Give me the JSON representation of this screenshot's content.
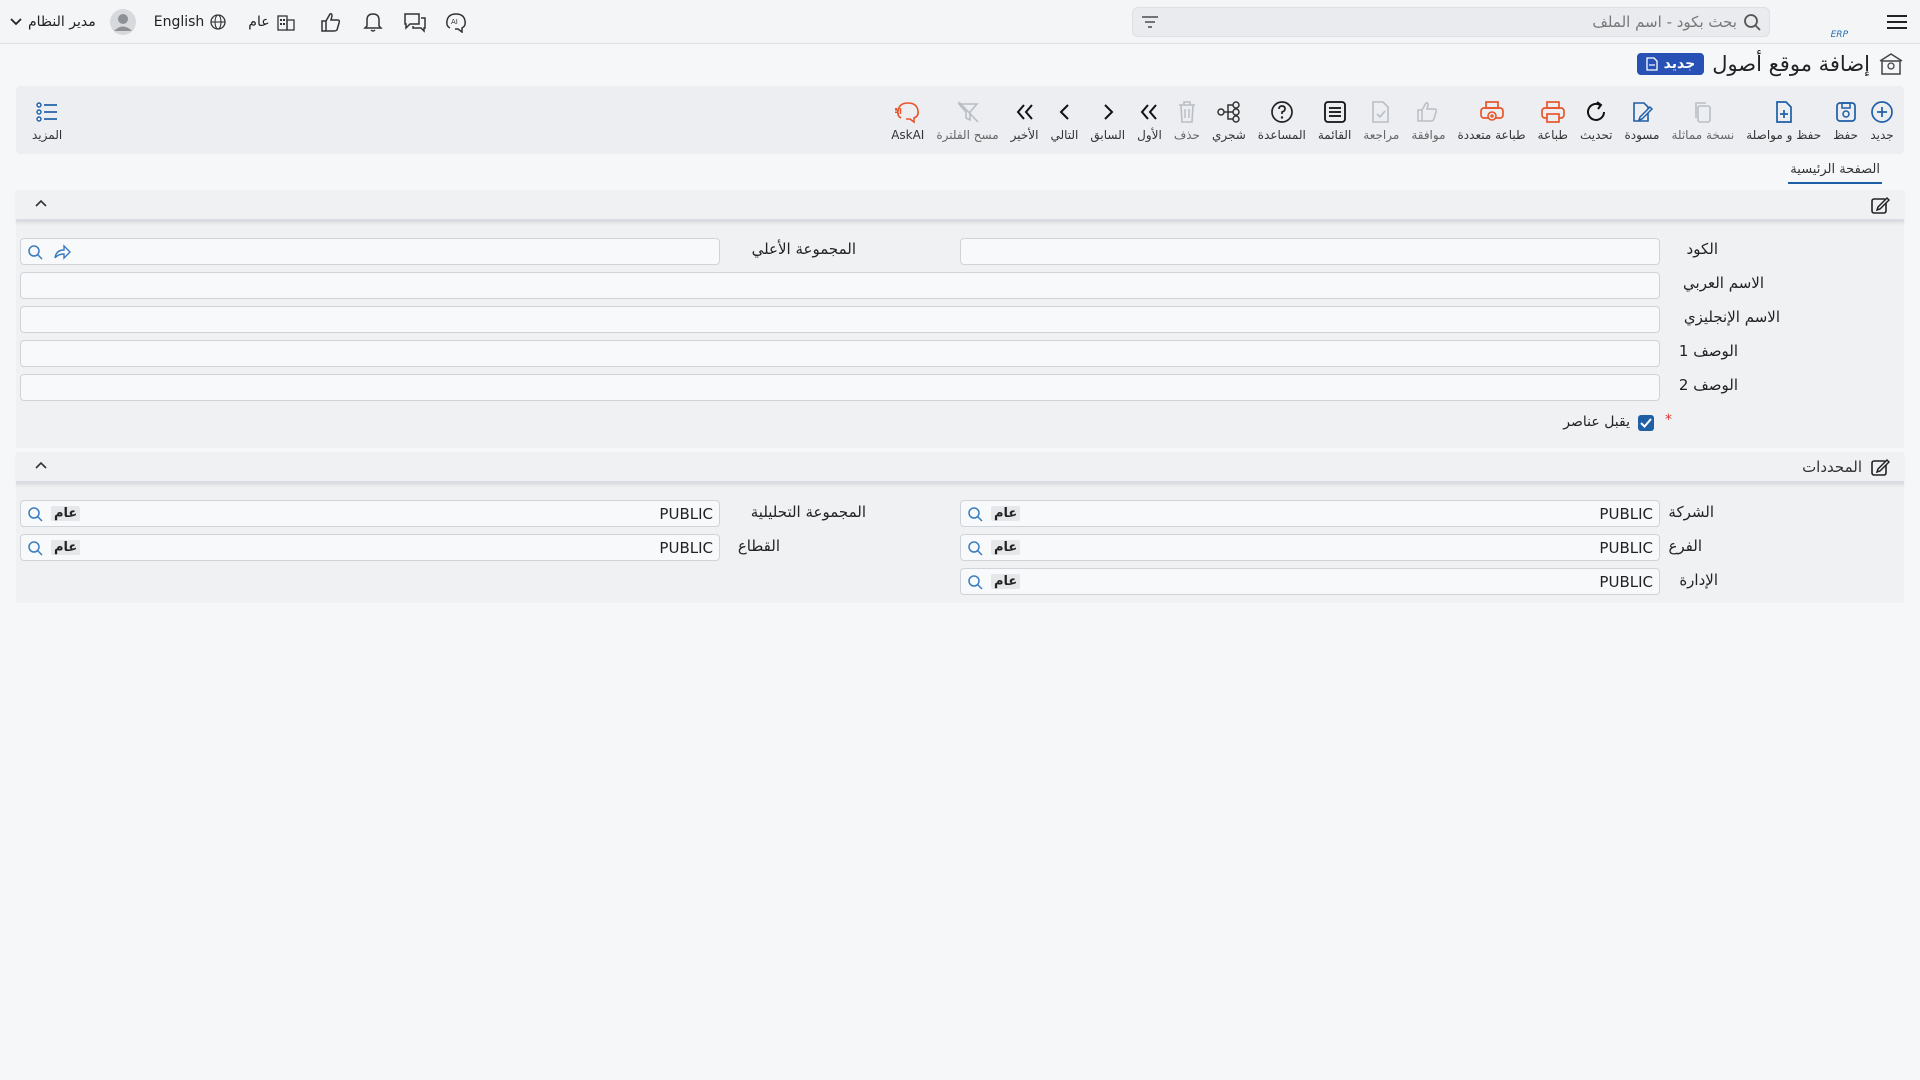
{
  "topbar": {
    "search_placeholder": "بحث بكود - اسم الملف",
    "user_name": "مدير النظام",
    "language": "English",
    "scope": "عام",
    "icons": [
      "hamburger-icon",
      "search-icon",
      "filter-icon",
      "user-avatar-icon",
      "chevron-down-icon",
      "globe-icon",
      "building-icon",
      "thumbs-up-icon",
      "bell-icon",
      "chat-icon",
      "ai-icon"
    ]
  },
  "header": {
    "title": "إضافة موقع أصول",
    "badge": "جديد"
  },
  "toolbar": {
    "items": [
      {
        "label": "جديد",
        "icon": "plus-circle-icon"
      },
      {
        "label": "حفظ",
        "icon": "save-icon"
      },
      {
        "label": "حفظ و مواصلة",
        "icon": "save-continue-icon"
      },
      {
        "label": "نسخة مماثلة",
        "icon": "copy-icon"
      },
      {
        "label": "مسودة",
        "icon": "draft-icon"
      },
      {
        "label": "تحديث",
        "icon": "refresh-icon"
      },
      {
        "label": "طباعة",
        "icon": "print-icon"
      },
      {
        "label": "طباعة متعددة",
        "icon": "multi-print-icon"
      },
      {
        "label": "موافقة",
        "icon": "approve-icon"
      },
      {
        "label": "مراجعة",
        "icon": "review-icon"
      },
      {
        "label": "القائمة",
        "icon": "list-icon"
      },
      {
        "label": "المساعدة",
        "icon": "help-icon"
      },
      {
        "label": "شجري",
        "icon": "tree-icon"
      },
      {
        "label": "حذف",
        "icon": "delete-icon"
      },
      {
        "label": "الأول",
        "icon": "first-icon"
      },
      {
        "label": "السابق",
        "icon": "previous-icon"
      },
      {
        "label": "التالي",
        "icon": "next-icon"
      },
      {
        "label": "الأخير",
        "icon": "last-icon"
      },
      {
        "label": "مسح الفلترة",
        "icon": "clear-filter-icon"
      },
      {
        "label": "AskAI",
        "icon": "ask-ai-icon"
      }
    ],
    "more_label": "المزيد"
  },
  "tabs": {
    "main": "الصفحة الرئيسية"
  },
  "main_section": {
    "code_label": "الكود",
    "code_value": "",
    "parent_group_label": "المجموعة الأعلي",
    "arabic_name_label": "الاسم العربي",
    "english_name_label": "الاسم الإنجليزي",
    "desc1_label": "الوصف 1",
    "desc2_label": "الوصف 2",
    "accepts_items_label": "يقبل عناصر",
    "accepts_items_checked": true,
    "required_mark": "*"
  },
  "determinants": {
    "title": "المحددات",
    "company_label": "الشركة",
    "company_value": "PUBLIC",
    "company_tag": "عام",
    "branch_label": "الفرع",
    "branch_value": "PUBLIC",
    "branch_tag": "عام",
    "department_label": "الإدارة",
    "department_value": "PUBLIC",
    "department_tag": "عام",
    "analytic_group_label": "المجموعة التحليلية",
    "analytic_group_value": "PUBLIC",
    "analytic_group_tag": "عام",
    "sector_label": "القطاع",
    "sector_value": "PUBLIC",
    "sector_tag": "عام"
  },
  "colors": {
    "accent": "#1e5fa8",
    "orange": "#e8552b",
    "badge": "#2751b5"
  }
}
